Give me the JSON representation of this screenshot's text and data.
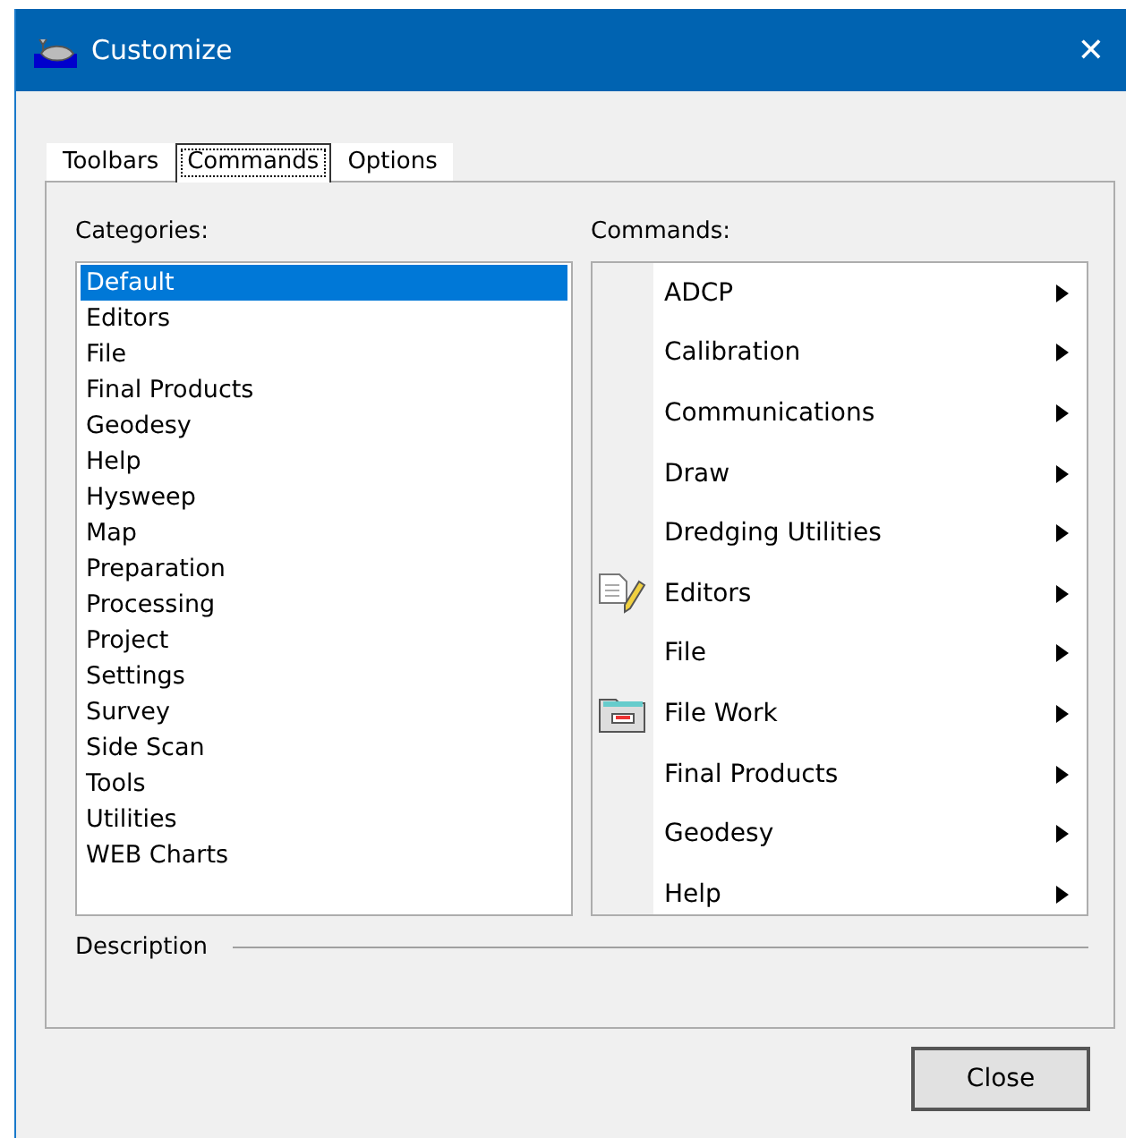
{
  "window": {
    "title": "Customize",
    "close": "✕"
  },
  "tabs": [
    {
      "label": "Toolbars",
      "selected": false
    },
    {
      "label": "Commands",
      "selected": true
    },
    {
      "label": "Options",
      "selected": false
    }
  ],
  "categories": {
    "label": "Categories:",
    "items": [
      {
        "label": "Default",
        "selected": true
      },
      {
        "label": "Editors",
        "selected": false
      },
      {
        "label": "File",
        "selected": false
      },
      {
        "label": "Final Products",
        "selected": false
      },
      {
        "label": "Geodesy",
        "selected": false
      },
      {
        "label": "Help",
        "selected": false
      },
      {
        "label": "Hysweep",
        "selected": false
      },
      {
        "label": "Map",
        "selected": false
      },
      {
        "label": "Preparation",
        "selected": false
      },
      {
        "label": "Processing",
        "selected": false
      },
      {
        "label": "Project",
        "selected": false
      },
      {
        "label": "Settings",
        "selected": false
      },
      {
        "label": "Survey",
        "selected": false
      },
      {
        "label": "Side Scan",
        "selected": false
      },
      {
        "label": "Tools",
        "selected": false
      },
      {
        "label": "Utilities",
        "selected": false
      },
      {
        "label": "WEB Charts",
        "selected": false
      }
    ]
  },
  "commands": {
    "label": "Commands:",
    "items": [
      {
        "label": "ADCP",
        "kind": "plain"
      },
      {
        "label": "Calibration",
        "kind": "plain"
      },
      {
        "label": "Communications",
        "kind": "plain"
      },
      {
        "label": "Draw",
        "kind": "plain"
      },
      {
        "label": "Dredging Utilities",
        "kind": "plain"
      },
      {
        "label": "Editors",
        "kind": "document"
      },
      {
        "label": "File",
        "kind": "plain"
      },
      {
        "label": "File Work",
        "kind": "folder"
      },
      {
        "label": "Final Products",
        "kind": "plain"
      },
      {
        "label": "Geodesy",
        "kind": "plain"
      },
      {
        "label": "Help",
        "kind": "plain"
      }
    ]
  },
  "description": {
    "label": "Description"
  },
  "buttons": [
    {
      "label": "Close"
    }
  ]
}
